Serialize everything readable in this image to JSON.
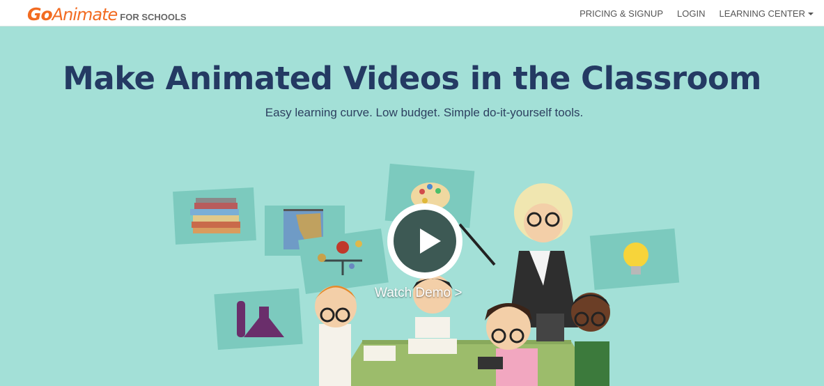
{
  "nav": {
    "logo_go": "Go",
    "logo_animate": "Animate",
    "logo_suffix": "FOR SCHOOLS",
    "links": [
      {
        "label": "PRICING & SIGNUP"
      },
      {
        "label": "LOGIN"
      },
      {
        "label": "LEARNING CENTER"
      }
    ]
  },
  "hero": {
    "title": "Make Animated Videos in the Classroom",
    "subtitle": "Easy learning curve. Low budget. Simple do-it-yourself tools.",
    "watch_demo": "Watch Demo >"
  },
  "colors": {
    "hero_bg": "#a3e0d7",
    "brand_orange": "#f26b21",
    "title_navy": "#243a63",
    "play_dark": "#3d5954"
  },
  "icons": [
    "books-icon",
    "map-icon",
    "solar-system-icon",
    "palette-icon",
    "lightbulb-icon",
    "flask-icon",
    "play-icon",
    "chevron-down-icon"
  ]
}
